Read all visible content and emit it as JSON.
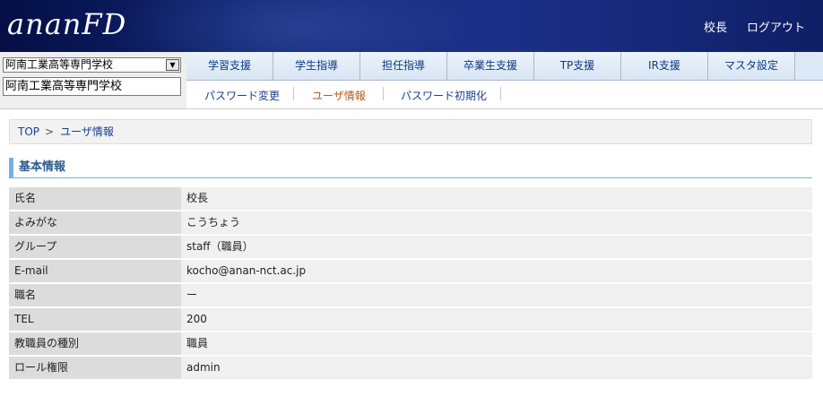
{
  "header": {
    "logo_text": "ananFD",
    "user_link": "校長",
    "logout_link": "ログアウト"
  },
  "school": {
    "selected": "阿南工業高等専門学校",
    "name_field": "阿南工業高等専門学校"
  },
  "main_nav": [
    {
      "label": "学習支援"
    },
    {
      "label": "学生指導"
    },
    {
      "label": "担任指導"
    },
    {
      "label": "卒業生支援"
    },
    {
      "label": "TP支援"
    },
    {
      "label": "IR支援"
    },
    {
      "label": "マスタ設定"
    }
  ],
  "sub_nav": [
    {
      "label": "パスワード変更"
    },
    {
      "label": "ユーザ情報"
    },
    {
      "label": "パスワード初期化"
    }
  ],
  "breadcrumb": {
    "top": "TOP",
    "chevron": ">",
    "current": "ユーザ情報"
  },
  "section": {
    "title": "基本情報"
  },
  "info": [
    {
      "label": "氏名",
      "value": "校長"
    },
    {
      "label": "よみがな",
      "value": "こうちょう"
    },
    {
      "label": "グループ",
      "value": "staff（職員）"
    },
    {
      "label": "E-mail",
      "value": "kocho@anan-nct.ac.jp"
    },
    {
      "label": "職名",
      "value": "ー"
    },
    {
      "label": "TEL",
      "value": "200"
    },
    {
      "label": "教職員の種別",
      "value": "職員"
    },
    {
      "label": "ロール権限",
      "value": "admin"
    }
  ],
  "colors": {
    "header_bg": "#102470",
    "tab_text": "#0c3a82",
    "active_sub": "#b35a1f",
    "section_accent": "#7ab0e0"
  }
}
